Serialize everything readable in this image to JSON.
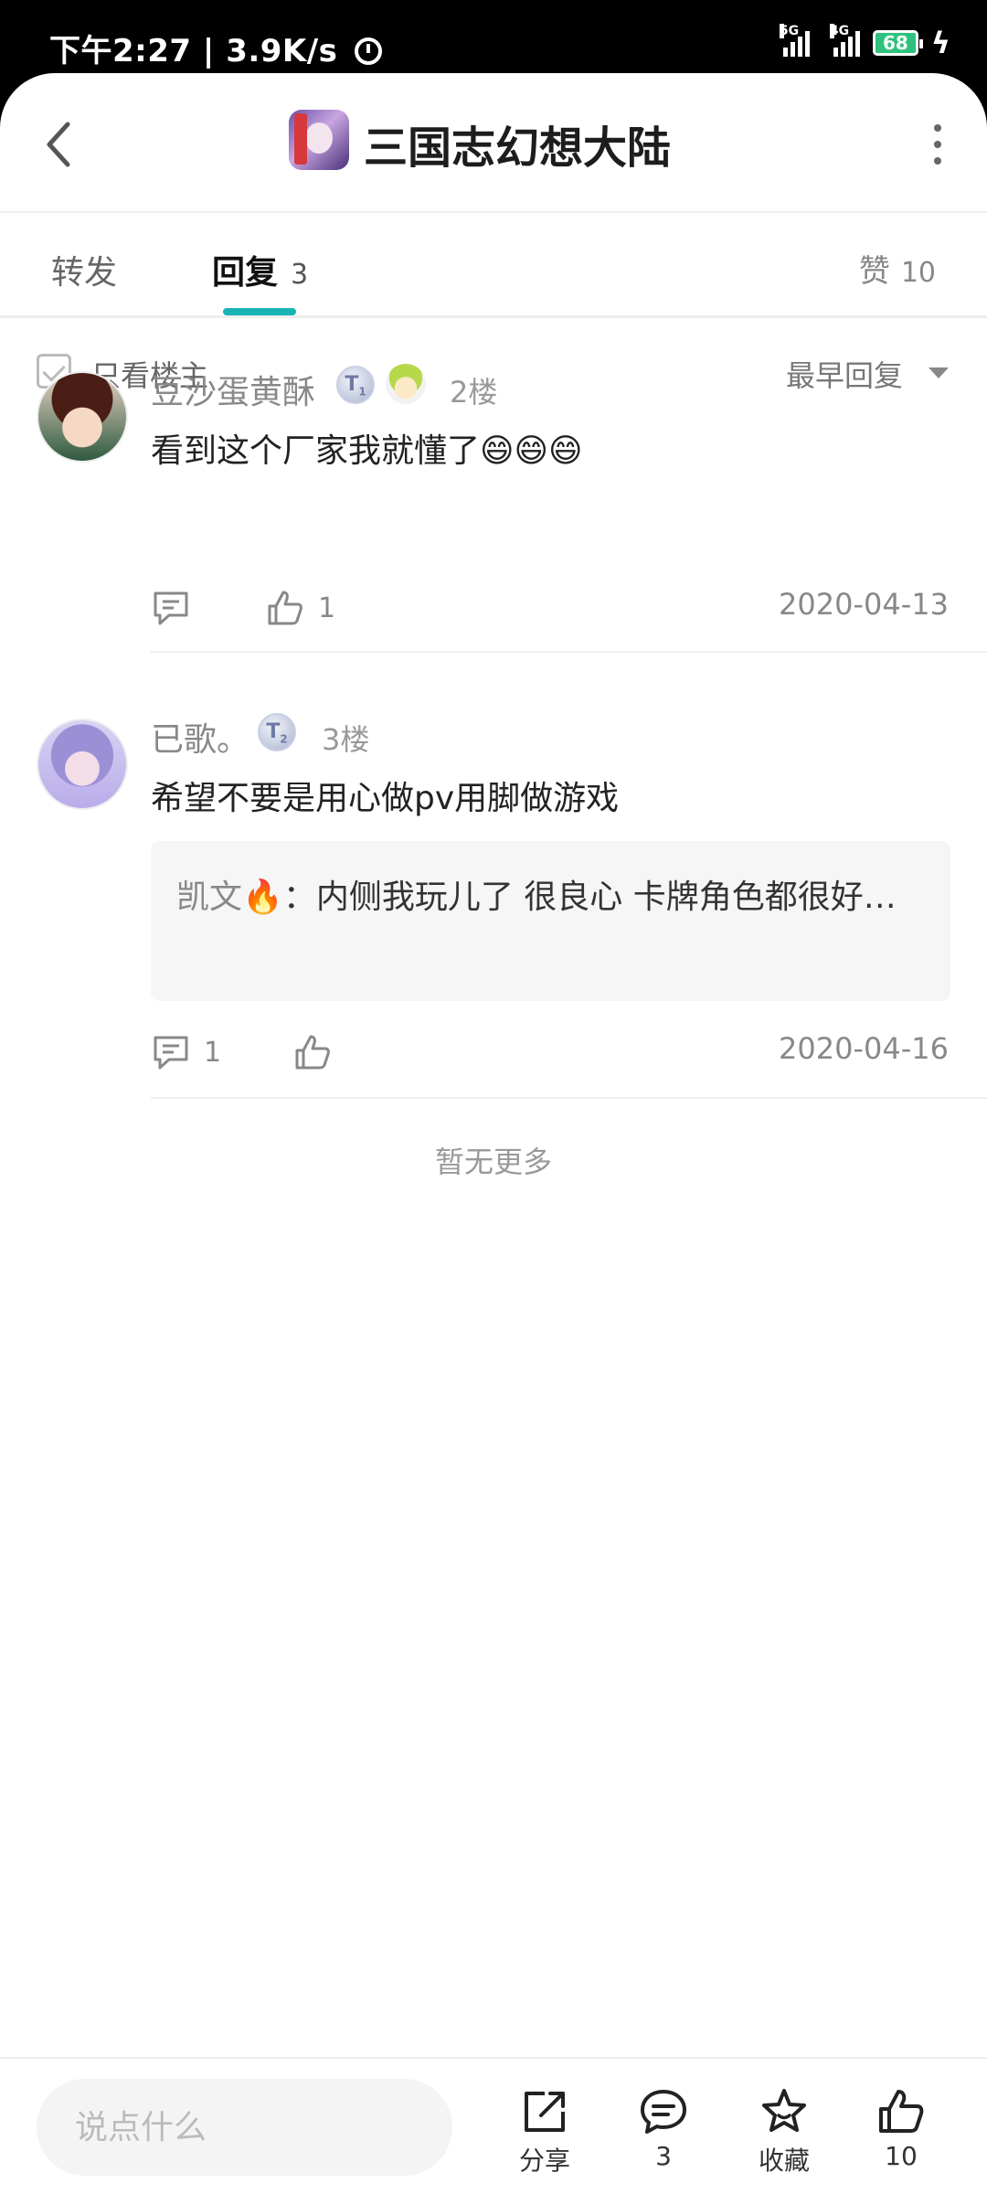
{
  "status_bar": {
    "time": "下午2:27",
    "speed": "3.9K/s",
    "network_1": "5G",
    "network_2": "4G",
    "hd": "HD",
    "battery": "68"
  },
  "header": {
    "title": "三国志幻想大陆"
  },
  "tabs": {
    "forward": "转发",
    "reply": "回复",
    "reply_count": "3",
    "like": "赞",
    "like_count": "10"
  },
  "filter": {
    "only_op": "只看楼主",
    "sort": "最早回复"
  },
  "replies": [
    {
      "username": "豆沙蛋黄酥",
      "badge": "T",
      "badge_level": "1",
      "floor": "2楼",
      "content": "看到这个厂家我就懂了😄😄😄",
      "comment_count": "",
      "like_count": "1",
      "date": "2020-04-13"
    },
    {
      "username": "已歌。",
      "badge": "T",
      "badge_level": "2",
      "floor": "3楼",
      "content": "希望不要是用心做pv用脚做游戏",
      "quote_name": "凯文🔥",
      "quote_text": "：内侧我玩儿了  很良心  卡牌角色都很好…",
      "comment_count": "1",
      "like_count": "",
      "date": "2020-04-16"
    }
  ],
  "no_more": "暂无更多",
  "bottom_bar": {
    "input_placeholder": "说点什么",
    "share": "分享",
    "comments": "3",
    "favorite": "收藏",
    "likes": "10"
  }
}
